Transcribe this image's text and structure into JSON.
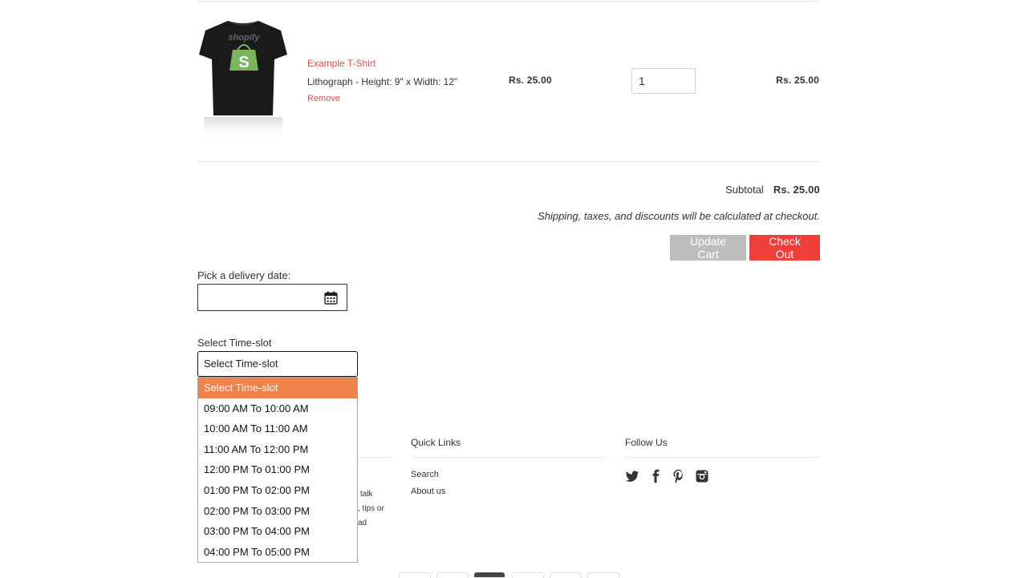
{
  "cart": {
    "item": {
      "title": "Example T-Shirt",
      "variant": "Lithograph - Height: 9\" x Width: 12\"",
      "remove_label": "Remove",
      "price": "Rs. 25.00",
      "quantity": "1",
      "line_total": "Rs. 25.00",
      "image_brand": "shopify"
    },
    "subtotal_label": "Subtotal",
    "subtotal_value": "Rs. 25.00",
    "note": "Shipping, taxes, and discounts will be calculated at checkout.",
    "update_label": "Update Cart",
    "checkout_label": "Check Out"
  },
  "delivery": {
    "date_label": "Pick a delivery date:",
    "date_value": "",
    "timeslot_label": "Select Time-slot",
    "selected": "Select Time-slot",
    "options": [
      "Select Time-slot",
      "09:00 AM To 10:00 AM",
      "10:00 AM To 11:00 AM",
      "11:00 AM To 12:00 PM",
      "12:00 PM To 01:00 PM",
      "01:00 PM To 02:00 PM",
      "02:00 PM To 03:00 PM",
      "03:00 PM To 04:00 PM",
      "04:00 PM To 05:00 PM"
    ]
  },
  "footer": {
    "quick_links_heading": "Quick Links",
    "quick_links": [
      "Search",
      "About us"
    ],
    "follow_heading": "Follow Us",
    "social_icons": [
      "twitter-icon",
      "facebook-icon",
      "pinterest-icon",
      "instagram-icon"
    ],
    "about_fragments": [
      "talk",
      ", tips or",
      "ad"
    ]
  },
  "colors": {
    "accent": "#d9534f",
    "checkout": "#ef3f3a",
    "update": "#bdbdbd",
    "dropdown_highlight": "#f0834b",
    "brand_green": "#7ab55c"
  }
}
